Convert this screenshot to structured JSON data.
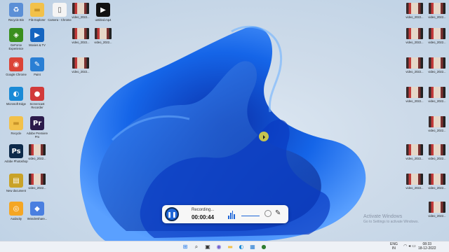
{
  "desktop": {
    "icons_left": [
      {
        "label": "Recycle Bin",
        "icon": "recycle-bin-icon",
        "color": "#5b8fd6"
      },
      {
        "label": "File Explorer",
        "icon": "folder-icon",
        "color": "#f2c14a"
      },
      {
        "label": "Camera - Chrome",
        "icon": "document-icon",
        "color": "#f4f4f4"
      },
      {
        "label": "video_2022...",
        "icon": "video-thumbnail-icon",
        "color": "#b83232"
      },
      {
        "label": "untitled.mp4",
        "icon": "media-player-icon",
        "color": "#111111"
      },
      {
        "label": "GeForce Experience",
        "icon": "nvidia-icon",
        "color": "#3a8f1e"
      },
      {
        "label": "Movies & TV",
        "icon": "movies-tv-icon",
        "color": "#1565c0"
      },
      {
        "label": "video_2022...",
        "icon": "video-thumbnail-icon",
        "color": "#b83232"
      },
      {
        "label": "video_2022...",
        "icon": "video-thumbnail-icon",
        "color": "#b83232"
      },
      {
        "label": "Google Chrome",
        "icon": "chrome-icon",
        "color": "#db4437"
      },
      {
        "label": "Paint",
        "icon": "paint-icon",
        "color": "#2a7fd4"
      },
      {
        "label": "video_2022...",
        "icon": "video-thumbnail-icon",
        "color": "#b83232"
      },
      {
        "label": "Microsoft Edge",
        "icon": "edge-icon",
        "color": "#1a8ad6"
      },
      {
        "label": "Screencast Recorder",
        "icon": "screen-recorder-icon",
        "color": "#d23a3a"
      },
      {
        "label": "Recycle",
        "icon": "folder-icon",
        "color": "#f2c14a"
      },
      {
        "label": "Adobe Premiere Pro",
        "icon": "premiere-pro-icon",
        "color": "#2b1a4a"
      },
      {
        "label": "Adobe Photoshop",
        "icon": "photoshop-icon",
        "color": "#0d2a4a"
      },
      {
        "label": "video_2022...",
        "icon": "video-thumbnail-icon",
        "color": "#b83232"
      },
      {
        "label": "New document",
        "icon": "archive-icon",
        "color": "#c9a227"
      },
      {
        "label": "video_2022...",
        "icon": "video-thumbnail-icon",
        "color": "#b83232"
      },
      {
        "label": "Audacity",
        "icon": "audacity-icon",
        "color": "#f5a623"
      },
      {
        "label": "Wondershare...",
        "icon": "app-icon",
        "color": "#4a7fe0"
      }
    ],
    "icons_right": [
      {
        "label": "video_2022...",
        "icon": "video-thumbnail-icon"
      },
      {
        "label": "video_2022...",
        "icon": "video-thumbnail-icon"
      },
      {
        "label": "video_2022...",
        "icon": "video-thumbnail-icon"
      },
      {
        "label": "video_2022...",
        "icon": "video-thumbnail-icon"
      },
      {
        "label": "video_2022...",
        "icon": "video-thumbnail-icon"
      },
      {
        "label": "video_2022...",
        "icon": "video-thumbnail-icon"
      },
      {
        "label": "video_2022...",
        "icon": "video-thumbnail-icon"
      },
      {
        "label": "video_2022...",
        "icon": "video-thumbnail-icon"
      },
      {
        "label": "video_2022...",
        "icon": "video-thumbnail-icon"
      },
      {
        "label": "video_2022...",
        "icon": "video-thumbnail-icon"
      },
      {
        "label": "video_2022...",
        "icon": "video-thumbnail-icon"
      },
      {
        "label": "video_2022...",
        "icon": "video-thumbnail-icon"
      },
      {
        "label": "video_2022...",
        "icon": "video-thumbnail-icon"
      },
      {
        "label": "video_2022...",
        "icon": "video-thumbnail-icon"
      }
    ]
  },
  "recorder": {
    "status": "Recording...",
    "elapsed": "00:00:44",
    "pause_icon": "pause-icon",
    "accent": "#1e66d8"
  },
  "watermark": {
    "title": "Activate Windows",
    "subtitle": "Go to Settings to activate Windows."
  },
  "taskbar": {
    "apps": [
      {
        "name": "start",
        "glyph": "⊞",
        "color": "#1a73e8"
      },
      {
        "name": "search",
        "glyph": "⌕",
        "color": "#333333"
      },
      {
        "name": "task-view",
        "glyph": "▣",
        "color": "#333333"
      },
      {
        "name": "chat",
        "glyph": "◉",
        "color": "#6a5acd"
      },
      {
        "name": "file-explorer",
        "glyph": "▬",
        "color": "#f2c14a"
      },
      {
        "name": "edge",
        "glyph": "◐",
        "color": "#1a8ad6"
      },
      {
        "name": "store",
        "glyph": "▦",
        "color": "#2a7fd4"
      },
      {
        "name": "recorder",
        "glyph": "●",
        "color": "#2e7d32"
      }
    ],
    "lang_line1": "ENG",
    "lang_line2": "IN",
    "time": "08:33",
    "date": "18-12-2022"
  }
}
